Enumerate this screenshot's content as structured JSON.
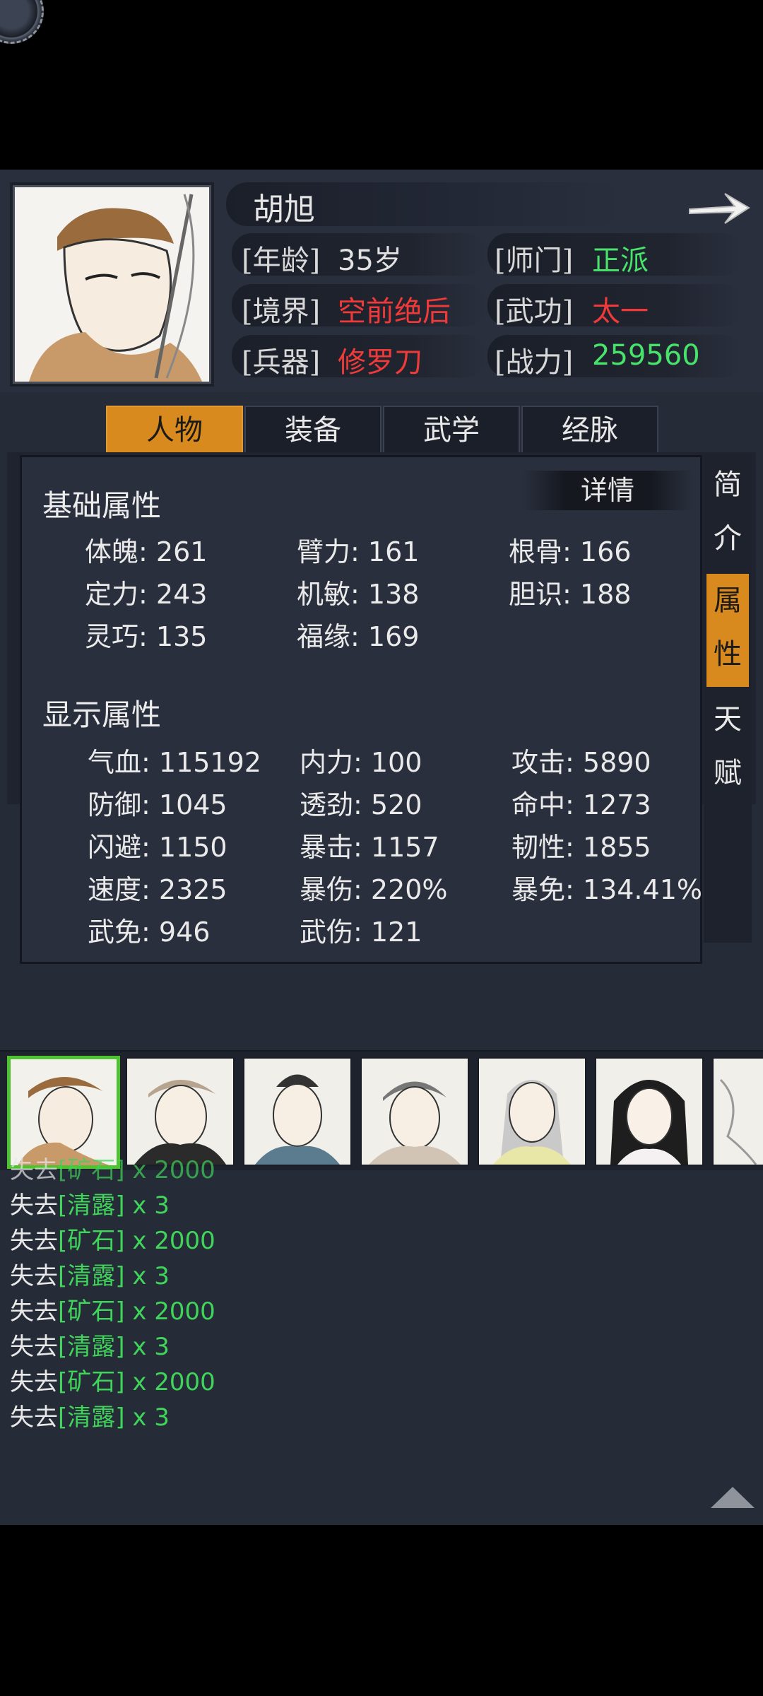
{
  "character": {
    "name": "胡旭",
    "rows": [
      {
        "key": "[年龄]",
        "value": "35岁",
        "color": "white"
      },
      {
        "key": "[师门]",
        "value": "正派",
        "color": "green"
      },
      {
        "key": "[境界]",
        "value": "空前绝后",
        "color": "red"
      },
      {
        "key": "[武功]",
        "value": "太一",
        "color": "red"
      },
      {
        "key": "[兵器]",
        "value": "修罗刀",
        "color": "red"
      },
      {
        "key": "[战力]",
        "value": "259560",
        "color": "green"
      }
    ]
  },
  "tabs": [
    "人物",
    "装备",
    "武学",
    "经脉"
  ],
  "active_tab": "人物",
  "side_tabs": [
    "简介",
    "属性",
    "天赋"
  ],
  "active_side_tab": "属性",
  "detail_label": "详情",
  "base_section": {
    "title": "基础属性",
    "stats": [
      {
        "k": "体魄",
        "v": "261"
      },
      {
        "k": "臂力",
        "v": "161"
      },
      {
        "k": "根骨",
        "v": "166"
      },
      {
        "k": "定力",
        "v": "243"
      },
      {
        "k": "机敏",
        "v": "138"
      },
      {
        "k": "胆识",
        "v": "188"
      },
      {
        "k": "灵巧",
        "v": "135"
      },
      {
        "k": "福缘",
        "v": "169"
      }
    ]
  },
  "display_section": {
    "title": "显示属性",
    "stats": [
      {
        "k": "气血",
        "v": "115192"
      },
      {
        "k": "内力",
        "v": "100"
      },
      {
        "k": "攻击",
        "v": "5890"
      },
      {
        "k": "防御",
        "v": "1045"
      },
      {
        "k": "透劲",
        "v": "520"
      },
      {
        "k": "命中",
        "v": "1273"
      },
      {
        "k": "闪避",
        "v": "1150"
      },
      {
        "k": "暴击",
        "v": "1157"
      },
      {
        "k": "韧性",
        "v": "1855"
      },
      {
        "k": "速度",
        "v": "2325"
      },
      {
        "k": "暴伤",
        "v": "220%"
      },
      {
        "k": "暴免",
        "v": "134.41%"
      },
      {
        "k": "武免",
        "v": "946"
      },
      {
        "k": "武伤",
        "v": "121"
      }
    ]
  },
  "roster": {
    "count_visible": 7,
    "selected_index": 0
  },
  "log": [
    {
      "prefix": "失去",
      "item": "[矿石]",
      "qty": "x 2000"
    },
    {
      "prefix": "失去",
      "item": "[清露]",
      "qty": "x 3"
    },
    {
      "prefix": "失去",
      "item": "[矿石]",
      "qty": "x 2000"
    },
    {
      "prefix": "失去",
      "item": "[清露]",
      "qty": "x 3"
    },
    {
      "prefix": "失去",
      "item": "[矿石]",
      "qty": "x 2000"
    },
    {
      "prefix": "失去",
      "item": "[清露]",
      "qty": "x 3"
    },
    {
      "prefix": "失去",
      "item": "[矿石]",
      "qty": "x 2000"
    },
    {
      "prefix": "失去",
      "item": "[清露]",
      "qty": "x 3"
    }
  ],
  "colors": {
    "accent": "#d98a1e",
    "green": "#47e36a",
    "red": "#f03a3a",
    "selected_border": "#4ec231"
  }
}
